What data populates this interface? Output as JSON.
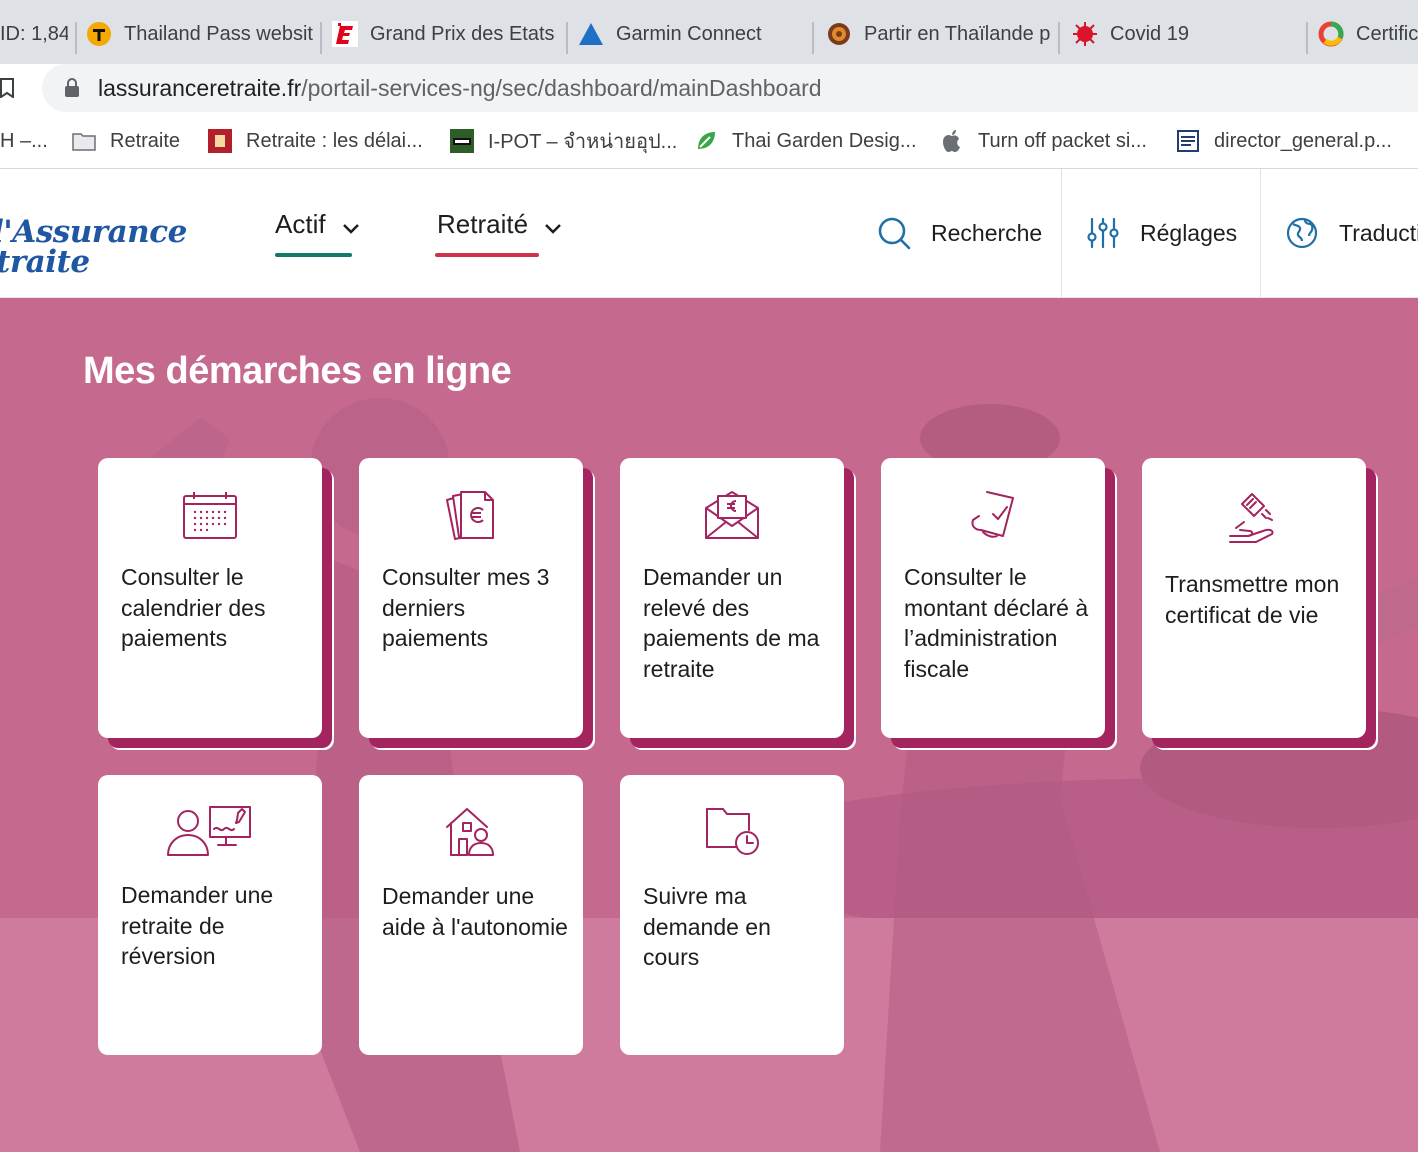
{
  "browser": {
    "tabs": [
      {
        "title": "ID: 1,84",
        "icon": "none"
      },
      {
        "title": "Thailand Pass websit",
        "icon": "thailand-pass-icon"
      },
      {
        "title": "Grand Prix des Etats",
        "icon": "lequipe-icon"
      },
      {
        "title": "Garmin Connect",
        "icon": "garmin-icon"
      },
      {
        "title": "Partir en Thaïlande p",
        "icon": "embassy-seal-icon"
      },
      {
        "title": "Covid 19",
        "icon": "covid-icon"
      },
      {
        "title": "Certific",
        "icon": "chrome-ring-icon"
      }
    ],
    "url_domain": "lassuranceretraite.fr",
    "url_path": "/portail-services-ng/sec/dashboard/mainDashboard",
    "bookmarks": [
      {
        "label": "H –...",
        "icon": "none"
      },
      {
        "label": "Retraite",
        "icon": "folder-icon"
      },
      {
        "label": "Retraite : les délai...",
        "icon": "retraite-site-icon"
      },
      {
        "label": "I-POT – จำหน่ายอุป...",
        "icon": "ipot-icon"
      },
      {
        "label": "Thai Garden Desig...",
        "icon": "leaf-icon"
      },
      {
        "label": "Turn off packet si...",
        "icon": "apple-icon"
      },
      {
        "label": "director_general.p...",
        "icon": "document-icon"
      }
    ]
  },
  "site": {
    "logo_line1": "l'Assurance",
    "logo_line2": "traite",
    "nav": [
      {
        "label": "Actif",
        "underline_color": "#127a6b"
      },
      {
        "label": "Retraité",
        "underline_color": "#d0324c"
      }
    ],
    "tools": {
      "search": "Recherche",
      "settings": "Réglages",
      "translate": "Traducti"
    }
  },
  "hero": {
    "title": "Mes démarches en ligne",
    "background_color": "#c6698f",
    "accent_color": "#a3245f",
    "cards": [
      {
        "label": "Consulter le calendrier des paiements",
        "icon": "calendar-icon"
      },
      {
        "label": "Consulter mes 3 derniers paiements",
        "icon": "euro-documents-icon"
      },
      {
        "label": "Demander un relevé des paiements de ma retraite",
        "icon": "euro-envelope-icon"
      },
      {
        "label": "Consulter le montant déclaré à l’administration fiscale",
        "icon": "signed-document-icon"
      },
      {
        "label": "Transmettre mon certificat de vie",
        "icon": "hand-document-icon"
      },
      {
        "label": "Demander une retraite de réversion",
        "icon": "person-computer-icon"
      },
      {
        "label": "Demander une aide à l'autonomie",
        "icon": "house-person-icon"
      },
      {
        "label": "Suivre ma demande en cours",
        "icon": "folder-clock-icon"
      }
    ]
  }
}
